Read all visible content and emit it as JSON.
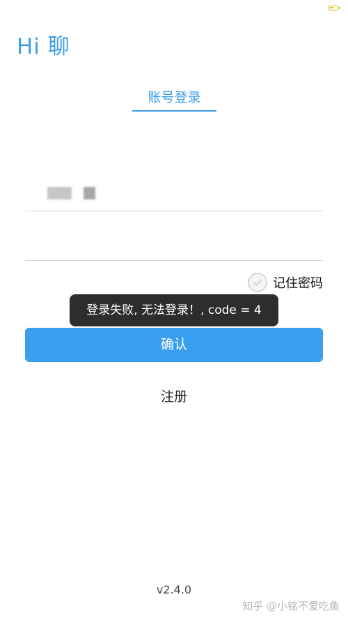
{
  "app": {
    "title": "Hi 聊"
  },
  "tabs": {
    "active_label": "账号登录"
  },
  "form": {
    "account_value": "",
    "password_value": "",
    "remember_label": "记住密码",
    "remember_checked": false
  },
  "toast": {
    "message": "登录失败, 无法登录！, code = 4"
  },
  "actions": {
    "confirm_label": "确认",
    "register_label": "注册"
  },
  "footer": {
    "version": "v2.4.0",
    "watermark": "知乎 @小铭不爱吃鱼"
  },
  "colors": {
    "accent": "#3d9de9",
    "button": "#3b9ff0",
    "toast_bg": "#2d2d2d",
    "battery": "#e2b400"
  },
  "icons": {
    "battery": "battery-icon",
    "checkbox": "check-circle-icon"
  }
}
